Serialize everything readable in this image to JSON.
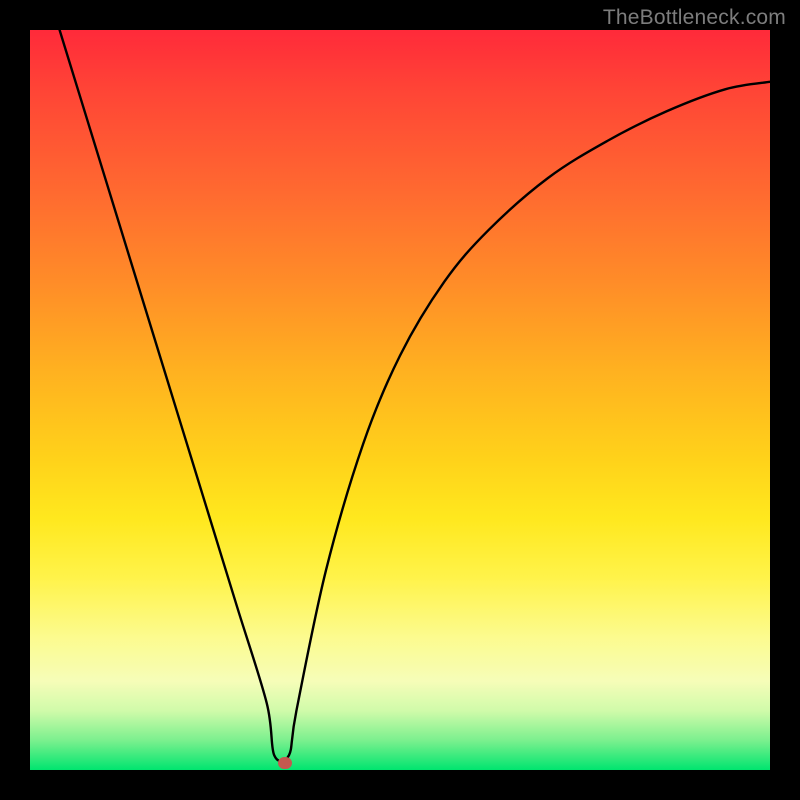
{
  "watermark": "TheBottleneck.com",
  "marker": {
    "x_pct": 34.5,
    "y_pct": 99.0
  },
  "chart_data": {
    "type": "line",
    "title": "",
    "xlabel": "",
    "ylabel": "",
    "xlim": [
      0,
      100
    ],
    "ylim": [
      0,
      100
    ],
    "series": [
      {
        "name": "curve",
        "x": [
          4,
          8,
          12,
          16,
          20,
          24,
          28,
          32,
          33,
          35,
          36,
          40,
          45,
          50,
          56,
          62,
          70,
          78,
          86,
          94,
          100
        ],
        "y": [
          100,
          87,
          74,
          61,
          48,
          35,
          22,
          9,
          2,
          2,
          8,
          27,
          44,
          56,
          66,
          73,
          80,
          85,
          89,
          92,
          93
        ]
      }
    ],
    "annotations": [
      {
        "type": "point",
        "x": 34.5,
        "y": 1.0,
        "name": "minimum-marker"
      }
    ]
  }
}
